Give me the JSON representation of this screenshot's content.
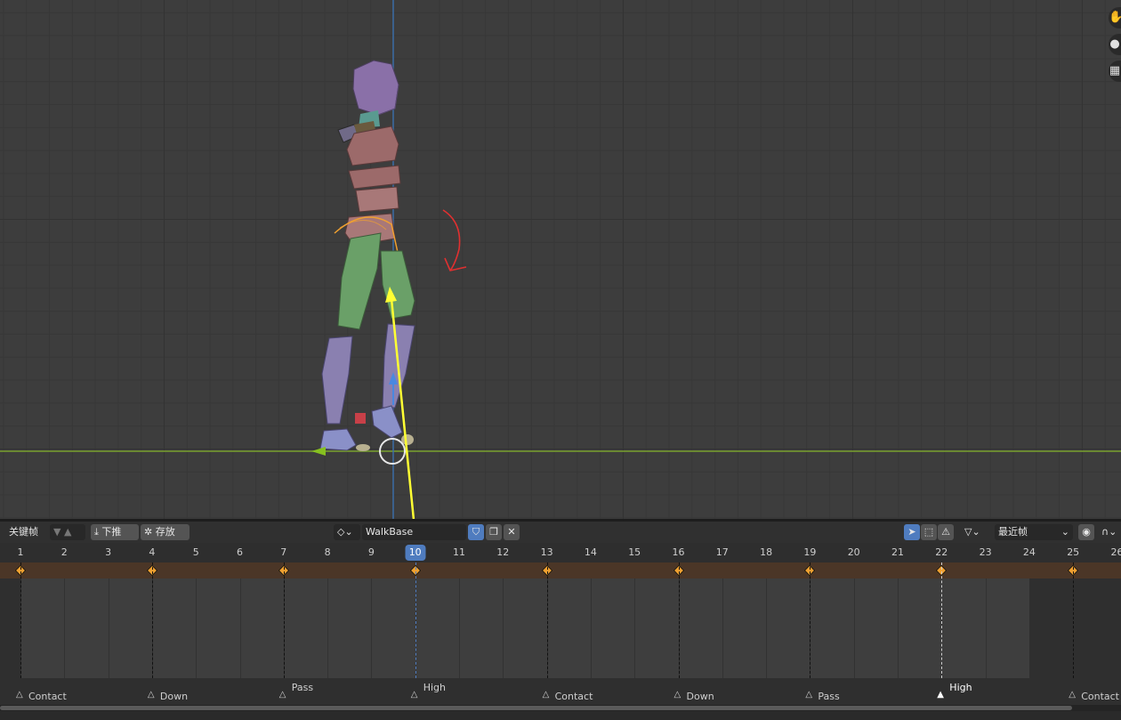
{
  "header": {
    "mode_label": "关键帧",
    "push_down_label": "下推",
    "stash_label": "存放",
    "action_name": "WalkBase",
    "snapping_label": "最近帧"
  },
  "timeline": {
    "frames": [
      "1",
      "2",
      "3",
      "4",
      "5",
      "6",
      "7",
      "8",
      "9",
      "10",
      "11",
      "12",
      "13",
      "14",
      "15",
      "16",
      "17",
      "18",
      "19",
      "20",
      "21",
      "22",
      "23",
      "24",
      "25",
      "26"
    ],
    "current_frame": "10",
    "keyframes": [
      1,
      4,
      7,
      10,
      13,
      16,
      19,
      22,
      25
    ]
  },
  "markers": [
    {
      "frame": 1,
      "label": "Contact"
    },
    {
      "frame": 4,
      "label": "Down"
    },
    {
      "frame": 7,
      "label": "Pass"
    },
    {
      "frame": 10,
      "label": "High"
    },
    {
      "frame": 13,
      "label": "Contact"
    },
    {
      "frame": 16,
      "label": "Down"
    },
    {
      "frame": 19,
      "label": "Pass"
    },
    {
      "frame": 22,
      "label": "High"
    },
    {
      "frame": 25,
      "label": "Contact"
    }
  ],
  "colors": {
    "current_frame": "#4f7cbf",
    "keyframe": "#f0a030",
    "summary_row": "#4b3627",
    "annotation_arrow": "#ffff33",
    "annotation_curve": "#e03030"
  }
}
